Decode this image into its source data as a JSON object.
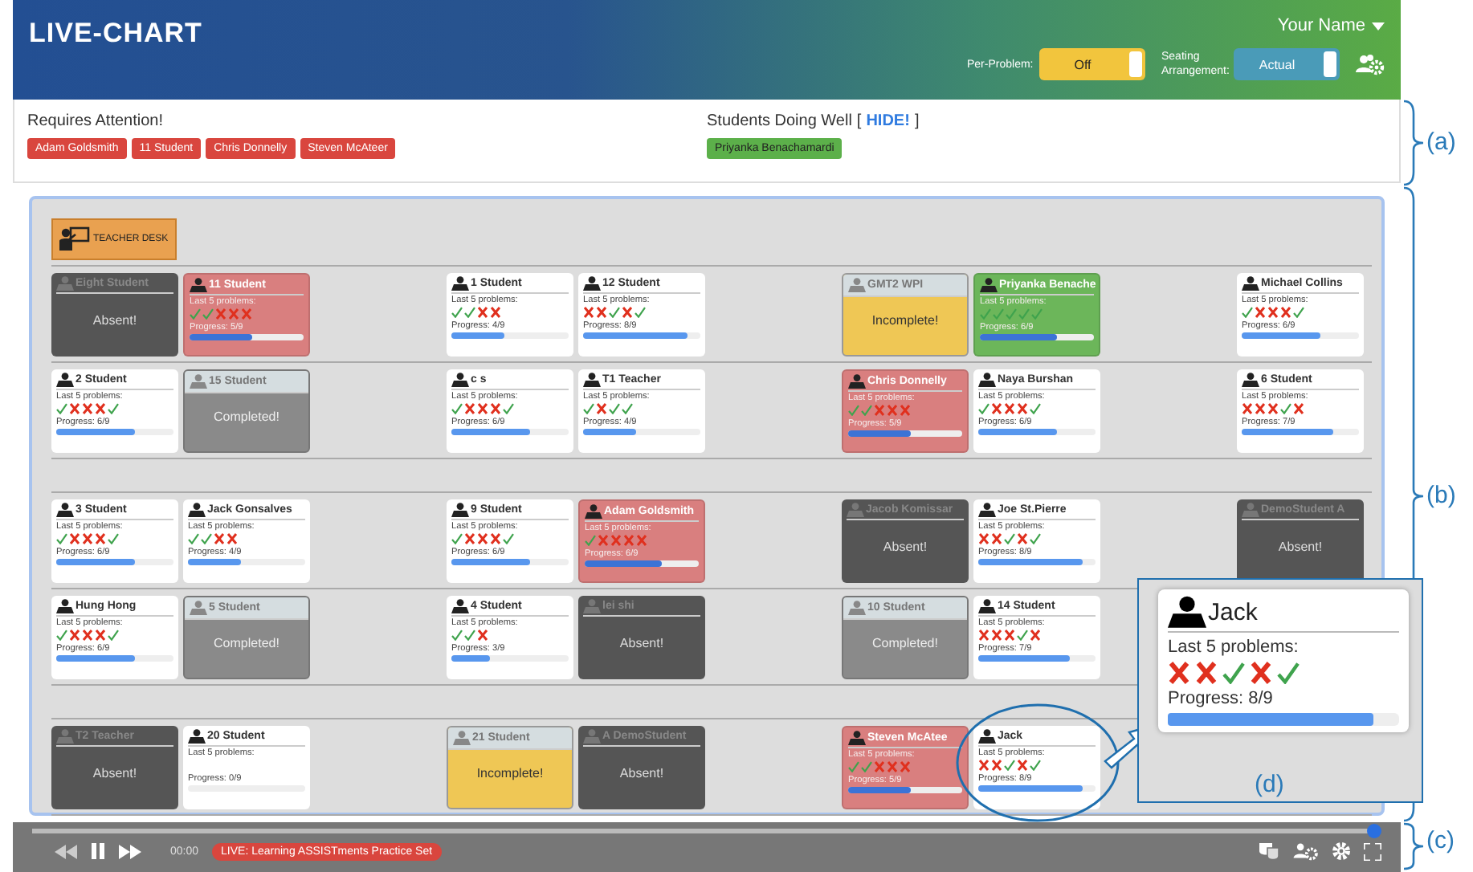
{
  "header": {
    "logo": "LIVE-CHART",
    "user": "Your Name",
    "toggles": [
      {
        "label": "Per-Problem:",
        "value": "Off",
        "color": "#f2c53d"
      },
      {
        "label": "Seating Arrangement:",
        "value": "Actual",
        "color": "#4a9bb8"
      }
    ]
  },
  "attention": {
    "title": "Requires Attention!",
    "students": [
      "Adam Goldsmith",
      "11 Student",
      "Chris Donnelly",
      "Steven McAteer"
    ]
  },
  "doing_well": {
    "title": "Students Doing Well",
    "bracket_open": "[",
    "hide_link": "HIDE!",
    "bracket_close": "]",
    "students": [
      "Priyanka Benachamardi"
    ]
  },
  "teacher_desk": {
    "label": "TEACHER DESK"
  },
  "groups": [
    {
      "rows": [
        [
          {
            "kind": "absent",
            "name": "Eight Student",
            "note": "Absent!"
          },
          {
            "kind": "student",
            "name": "11 Student",
            "color": "#d97f7f",
            "caption": "Last 5 problems:",
            "results": [
              true,
              true,
              false,
              false,
              false
            ],
            "progress": "Progress: 5/9",
            "level": 0.55
          },
          {
            "kind": "empty"
          },
          {
            "kind": "student",
            "name": "1 Student",
            "caption": "Last 5 problems:",
            "results": [
              true,
              true,
              false,
              false
            ],
            "progress": "Progress: 4/9",
            "level": 0.45
          },
          {
            "kind": "student",
            "name": "12 Student",
            "caption": "Last 5 problems:",
            "results": [
              false,
              false,
              true,
              false,
              true
            ],
            "progress": "Progress: 8/9",
            "level": 0.89
          },
          {
            "kind": "empty"
          },
          {
            "kind": "incomplete",
            "name": "GMT2 WPI",
            "note": "Incomplete!"
          },
          {
            "kind": "student",
            "name": "Priyanka Benache",
            "color": "#6cb65a",
            "caption": "Last 5 problems:",
            "results": [
              true,
              true,
              true,
              true,
              true
            ],
            "progress": "Progress: 6/9",
            "level": 0.67
          },
          {
            "kind": "empty"
          },
          {
            "kind": "student",
            "name": "Michael Collins",
            "caption": "Last 5 problems:",
            "results": [
              true,
              false,
              false,
              false,
              true
            ],
            "progress": "Progress: 6/9",
            "level": 0.67
          }
        ],
        [
          {
            "kind": "student",
            "name": "2 Student",
            "caption": "Last 5 problems:",
            "results": [
              true,
              false,
              false,
              false,
              true
            ],
            "progress": "Progress: 6/9",
            "level": 0.67
          },
          {
            "kind": "completed",
            "name": "15 Student",
            "note": "Completed!"
          },
          {
            "kind": "empty"
          },
          {
            "kind": "student",
            "name": "c s",
            "caption": "Last 5 problems:",
            "results": [
              true,
              false,
              false,
              false,
              true
            ],
            "progress": "Progress: 6/9",
            "level": 0.67
          },
          {
            "kind": "student",
            "name": "T1 Teacher",
            "caption": "Last 5 problems:",
            "results": [
              true,
              false,
              true,
              true
            ],
            "progress": "Progress: 4/9",
            "level": 0.45
          },
          {
            "kind": "empty"
          },
          {
            "kind": "student",
            "name": "Chris Donnelly",
            "color": "#d97f7f",
            "caption": "Last 5 problems:",
            "results": [
              true,
              true,
              false,
              false,
              false
            ],
            "progress": "Progress: 5/9",
            "level": 0.55
          },
          {
            "kind": "student",
            "name": "Naya Burshan",
            "caption": "Last 5 problems:",
            "results": [
              true,
              false,
              false,
              false,
              true
            ],
            "progress": "Progress: 6/9",
            "level": 0.67
          },
          {
            "kind": "empty"
          },
          {
            "kind": "student",
            "name": "6 Student",
            "caption": "Last 5 problems:",
            "results": [
              false,
              false,
              false,
              true,
              false
            ],
            "progress": "Progress: 7/9",
            "level": 0.78
          }
        ]
      ]
    },
    {
      "rows": [
        [
          {
            "kind": "student",
            "name": "3 Student",
            "caption": "Last 5 problems:",
            "results": [
              true,
              false,
              false,
              false,
              true
            ],
            "progress": "Progress: 6/9",
            "level": 0.67
          },
          {
            "kind": "student",
            "name": "Jack Gonsalves",
            "caption": "Last 5 problems:",
            "results": [
              true,
              true,
              false,
              false
            ],
            "progress": "Progress: 4/9",
            "level": 0.45
          },
          {
            "kind": "empty"
          },
          {
            "kind": "student",
            "name": "9 Student",
            "caption": "Last 5 problems:",
            "results": [
              true,
              false,
              false,
              false,
              true
            ],
            "progress": "Progress: 6/9",
            "level": 0.67
          },
          {
            "kind": "student",
            "name": "Adam Goldsmith",
            "color": "#d97f7f",
            "caption": "Last 5 problems:",
            "results": [
              true,
              false,
              false,
              false,
              false
            ],
            "progress": "Progress: 6/9",
            "level": 0.67
          },
          {
            "kind": "empty"
          },
          {
            "kind": "absent",
            "name": "Jacob Komissar",
            "note": "Absent!"
          },
          {
            "kind": "student",
            "name": "Joe St.Pierre",
            "caption": "Last 5 problems:",
            "results": [
              false,
              false,
              true,
              false,
              true
            ],
            "progress": "Progress: 8/9",
            "level": 0.89
          },
          {
            "kind": "empty"
          },
          {
            "kind": "absent",
            "name": "DemoStudent A",
            "note": "Absent!"
          }
        ],
        [
          {
            "kind": "student",
            "name": "Hung Hong",
            "caption": "Last 5 problems:",
            "results": [
              true,
              false,
              false,
              false,
              true
            ],
            "progress": "Progress: 6/9",
            "level": 0.67
          },
          {
            "kind": "completed",
            "name": "5 Student",
            "note": "Completed!"
          },
          {
            "kind": "empty"
          },
          {
            "kind": "student",
            "name": "4 Student",
            "caption": "Last 5 problems:",
            "results": [
              true,
              true,
              false
            ],
            "progress": "Progress: 3/9",
            "level": 0.33
          },
          {
            "kind": "absent",
            "name": "lei shi",
            "note": "Absent!"
          },
          {
            "kind": "empty"
          },
          {
            "kind": "completed",
            "name": "10 Student",
            "note": "Completed!"
          },
          {
            "kind": "student",
            "name": "14 Student",
            "caption": "Last 5 problems:",
            "results": [
              false,
              false,
              false,
              true,
              false
            ],
            "progress": "Progress: 7/9",
            "level": 0.78
          }
        ]
      ]
    },
    {
      "rows": [
        [
          {
            "kind": "absent",
            "name": "T2 Teacher",
            "note": "Absent!"
          },
          {
            "kind": "student",
            "name": "20 Student",
            "caption": "Last 5 problems:",
            "progress": "Progress: 0/9"
          },
          {
            "kind": "empty"
          },
          {
            "kind": "incomplete",
            "name": "21 Student",
            "note": "Incomplete!"
          },
          {
            "kind": "absent",
            "name": "A DemoStudent",
            "note": "Absent!"
          },
          {
            "kind": "empty"
          },
          {
            "kind": "student",
            "name": "Steven McAtee",
            "color": "#d97f7f",
            "caption": "Last 5 problems:",
            "results": [
              true,
              true,
              false,
              false,
              false
            ],
            "progress": "Progress: 5/9",
            "level": 0.55
          },
          {
            "kind": "student",
            "name": "Jack",
            "caption": "Last 5 problems:",
            "results": [
              false,
              false,
              true,
              false,
              true
            ],
            "progress": "Progress: 8/9",
            "level": 0.89
          }
        ]
      ]
    }
  ],
  "player": {
    "level": 1,
    "time": "00:00",
    "session": "LIVE: Learning ASSISTments Practice Set"
  },
  "zoom_callout": {
    "name": "Jack",
    "caption": "Last 5 problems:",
    "results": [
      false,
      false,
      true,
      false,
      true
    ],
    "progress": "Progress: 8/9",
    "level": 0.89,
    "label": "(d)"
  },
  "annotations": [
    "(a)",
    "(b)",
    "(c)"
  ]
}
